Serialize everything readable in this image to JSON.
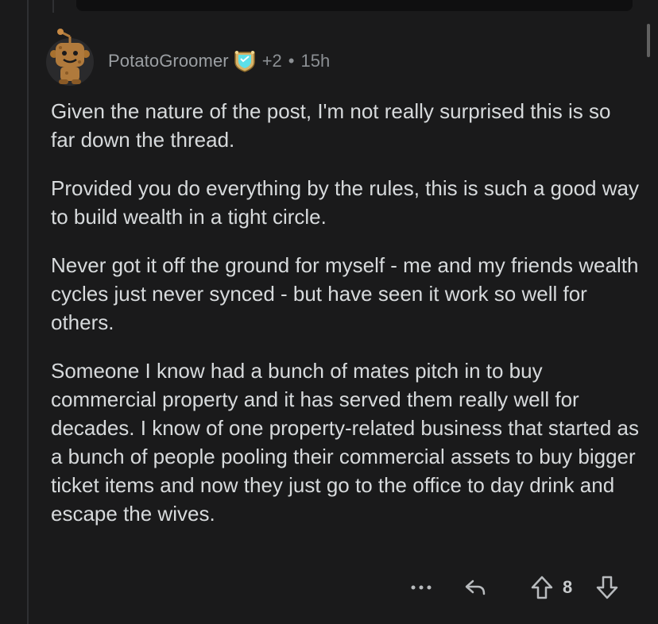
{
  "comment": {
    "username": "PotatoGroomer",
    "flair_points": "+2",
    "separator": "•",
    "time_ago": "15h",
    "paragraphs": [
      "Given the nature of the post, I'm not really surprised this is so far down the thread.",
      "Provided you do everything by the rules, this is such a good way to build wealth in a tight circle.",
      "Never got it off the ground for myself - me and my friends wealth cycles just never synced - but have seen it work so well for others.",
      "Someone I know had a bunch of mates pitch in to buy commercial property and it has served them really well for decades. I know of one property-related business that started as a bunch of people pooling their commercial assets to buy bigger ticket items and now they just go to the office to day drink and escape the wives."
    ],
    "avatar_icon": "snoo-avatar-icon",
    "badge_icon": "achievement-badge-icon",
    "colors": {
      "background": "#1a1a1b",
      "text": "#d7dadc",
      "muted": "#8c9094",
      "avatar_brown": "#b07a3c",
      "badge_cyan": "#5ee0e8",
      "badge_gold": "#d9b46a"
    }
  },
  "actions": {
    "more_icon": "more-dots-icon",
    "more_label": "•••",
    "reply_icon": "reply-arrow-icon",
    "upvote_icon": "upvote-arrow-icon",
    "vote_count": "8",
    "downvote_icon": "downvote-arrow-icon"
  }
}
